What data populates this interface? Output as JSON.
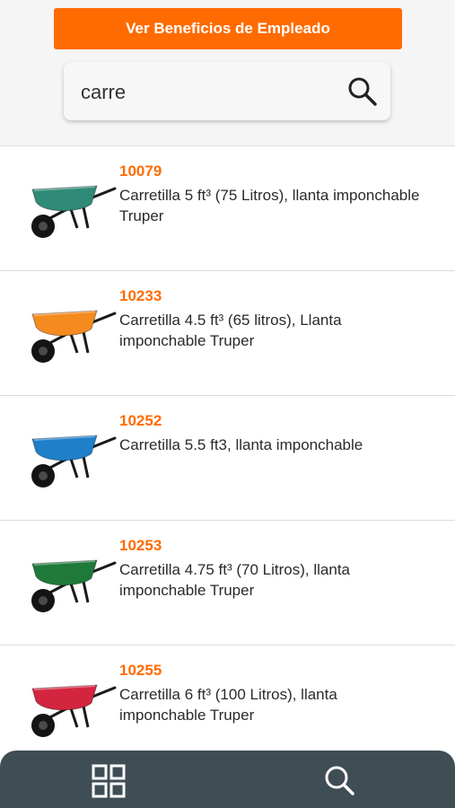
{
  "header": {
    "benefits_button": "Ver Beneficios de Empleado",
    "search_value": "carre",
    "search_icon": "search-icon",
    "accent_color": "#ff6b00"
  },
  "products": [
    {
      "code": "10079",
      "description": "Carretilla 5 ft³ (75 Litros), llanta imponchable Truper",
      "tray_color": "#2f8a78"
    },
    {
      "code": "10233",
      "description": "Carretilla 4.5 ft³ (65 litros), Llanta imponchable Truper",
      "tray_color": "#f58a1f"
    },
    {
      "code": "10252",
      "description": "Carretilla 5.5 ft3, llanta imponchable",
      "tray_color": "#1f7fc9"
    },
    {
      "code": "10253",
      "description": "Carretilla 4.75 ft³ (70 Litros), llanta imponchable Truper",
      "tray_color": "#1f7a3a"
    },
    {
      "code": "10255",
      "description": "Carretilla 6 ft³ (100 Litros), llanta imponchable Truper",
      "tray_color": "#d3253f"
    }
  ],
  "bottom_nav": {
    "background": "#3f4d54",
    "items": [
      "grid-icon",
      "search-icon"
    ]
  }
}
